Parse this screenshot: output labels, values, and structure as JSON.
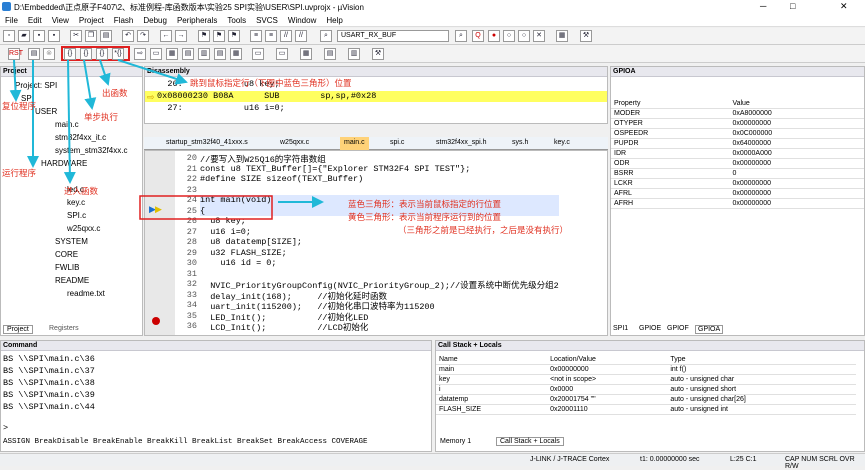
{
  "window": {
    "title": "D:\\Embedded\\正点原子F407\\2、标准例程-库函数版本\\实验25 SPI实验\\USER\\SPI.uvprojx - µVision",
    "min": "─",
    "max": "□",
    "close": "✕"
  },
  "menu": [
    "File",
    "Edit",
    "View",
    "Project",
    "Flash",
    "Debug",
    "Peripherals",
    "Tools",
    "SVCS",
    "Window",
    "Help"
  ],
  "toolbar": {
    "target": "USART_RX_BUF"
  },
  "project": {
    "title": "Project",
    "root": "Project: SPI",
    "items": [
      "SPI",
      "USER",
      "main.c",
      "stm32f4xx_it.c",
      "system_stm32f4xx.c",
      "HARDWARE",
      "led.c",
      "key.c",
      "SPI.c",
      "w25qxx.c",
      "SYSTEM",
      "CORE",
      "FWLIB",
      "README",
      "readme.txt"
    ],
    "tab_project": "Project",
    "tab_registers": "Registers"
  },
  "disassembly": {
    "title": "Disassembly",
    "lines": [
      "    26:            u8 key;",
      "0x08000230 B08A      SUB        sp,sp,#0x28",
      "    27:            u16 i=0;"
    ]
  },
  "tabs": [
    "startup_stm32f40_41xxx.s",
    "w25qxx.c",
    "main.c",
    "spi.c",
    "stm32f4xx_spi.h",
    "sys.h",
    "key.c"
  ],
  "editor": {
    "line_numbers": [
      "20",
      "21",
      "22",
      "23",
      "24",
      "25",
      "26",
      "27",
      "28",
      "29",
      "30",
      "31",
      "32",
      "33",
      "34",
      "35",
      "36"
    ],
    "lines": [
      "//要写入到W25Q16的字符串数组",
      "const u8 TEXT_Buffer[]={\"Explorer STM32F4 SPI TEST\"};",
      "#define SIZE sizeof(TEXT_Buffer)",
      "",
      "int main(void)",
      "{",
      "  u8 key;",
      "  u16 i=0;",
      "  u8 datatemp[SIZE];",
      "  u32 FLASH_SIZE;",
      "    u16 id = 0;",
      "",
      "  NVIC_PriorityGroupConfig(NVIC_PriorityGroup_2);//设置系统中断优先级分组2",
      "  delay_init(168);     //初始化延时函数",
      "  uart_init(115200);   //初始化串口波特率为115200",
      "  LED_Init();          //初始化LED",
      "  LCD_Init();          //LCD初始化"
    ]
  },
  "gpio": {
    "title": "GPIOA",
    "col_property": "Property",
    "col_value": "Value",
    "rows": [
      [
        "MODER",
        "0xA8000000"
      ],
      [
        "OTYPER",
        "0x00000000"
      ],
      [
        "OSPEEDR",
        "0x0C000000"
      ],
      [
        "PUPDR",
        "0x64000000"
      ],
      [
        "IDR",
        "0x0000A000"
      ],
      [
        "ODR",
        "0x00000000"
      ],
      [
        "BSRR",
        "0"
      ],
      [
        "LCKR",
        "0x00000000"
      ],
      [
        "AFRL",
        "0x00000000"
      ],
      [
        "AFRH",
        "0x00000000"
      ]
    ],
    "tabs": [
      "SPI1",
      "GPIOE",
      "GPIOF",
      "GPIOA"
    ]
  },
  "command": {
    "title": "Command",
    "lines": [
      "BS \\\\SPI\\main.c\\36",
      "BS \\\\SPI\\main.c\\37",
      "BS \\\\SPI\\main.c\\38",
      "BS \\\\SPI\\main.c\\39",
      "BS \\\\SPI\\main.c\\44"
    ],
    "input": ">",
    "help": "ASSIGN BreakDisable BreakEnable BreakKill BreakList BreakSet BreakAccess COVERAGE"
  },
  "callstack": {
    "title": "Call Stack + Locals",
    "col_name": "Name",
    "col_loc": "Location/Value",
    "col_type": "Type",
    "rows": [
      [
        "main",
        "0x00000000",
        "int f()"
      ],
      [
        "key",
        "<not in scope>",
        "auto - unsigned char"
      ],
      [
        "i",
        "0x0000",
        "auto - unsigned short"
      ],
      [
        "datatemp",
        "0x20001754 \"\"",
        "auto - unsigned char[26]"
      ],
      [
        "FLASH_SIZE",
        "0x20001110",
        "auto - unsigned int"
      ]
    ],
    "tab_memory": "Memory 1",
    "tab_callstack": "Call Stack + Locals"
  },
  "status": {
    "debugger": "J-LINK / J-TRACE Cortex",
    "time": "t1: 0.00000000 sec",
    "pos": "L:25 C:1",
    "caps": "CAP NUM SCRL OVR R/W"
  },
  "annotations": {
    "reset": "复位程序",
    "run": "运行程序",
    "step": "单步执行",
    "step_over": "进入函数",
    "step_out": "出函数",
    "run_to": "跳到鼠标指定行（下图中蓝色三角形）位置",
    "blue": "蓝色三角形：表示当前鼠标指定的行位置",
    "yellow": "黄色三角形：表示当前程序运行到的位置",
    "note": "（三角形之前是已经执行，之后是没有执行）"
  },
  "colors": {
    "accent": "#2d72c4",
    "annotation": "#e03020",
    "arrow": "#20b8d8",
    "highlight": "#ffff60"
  }
}
